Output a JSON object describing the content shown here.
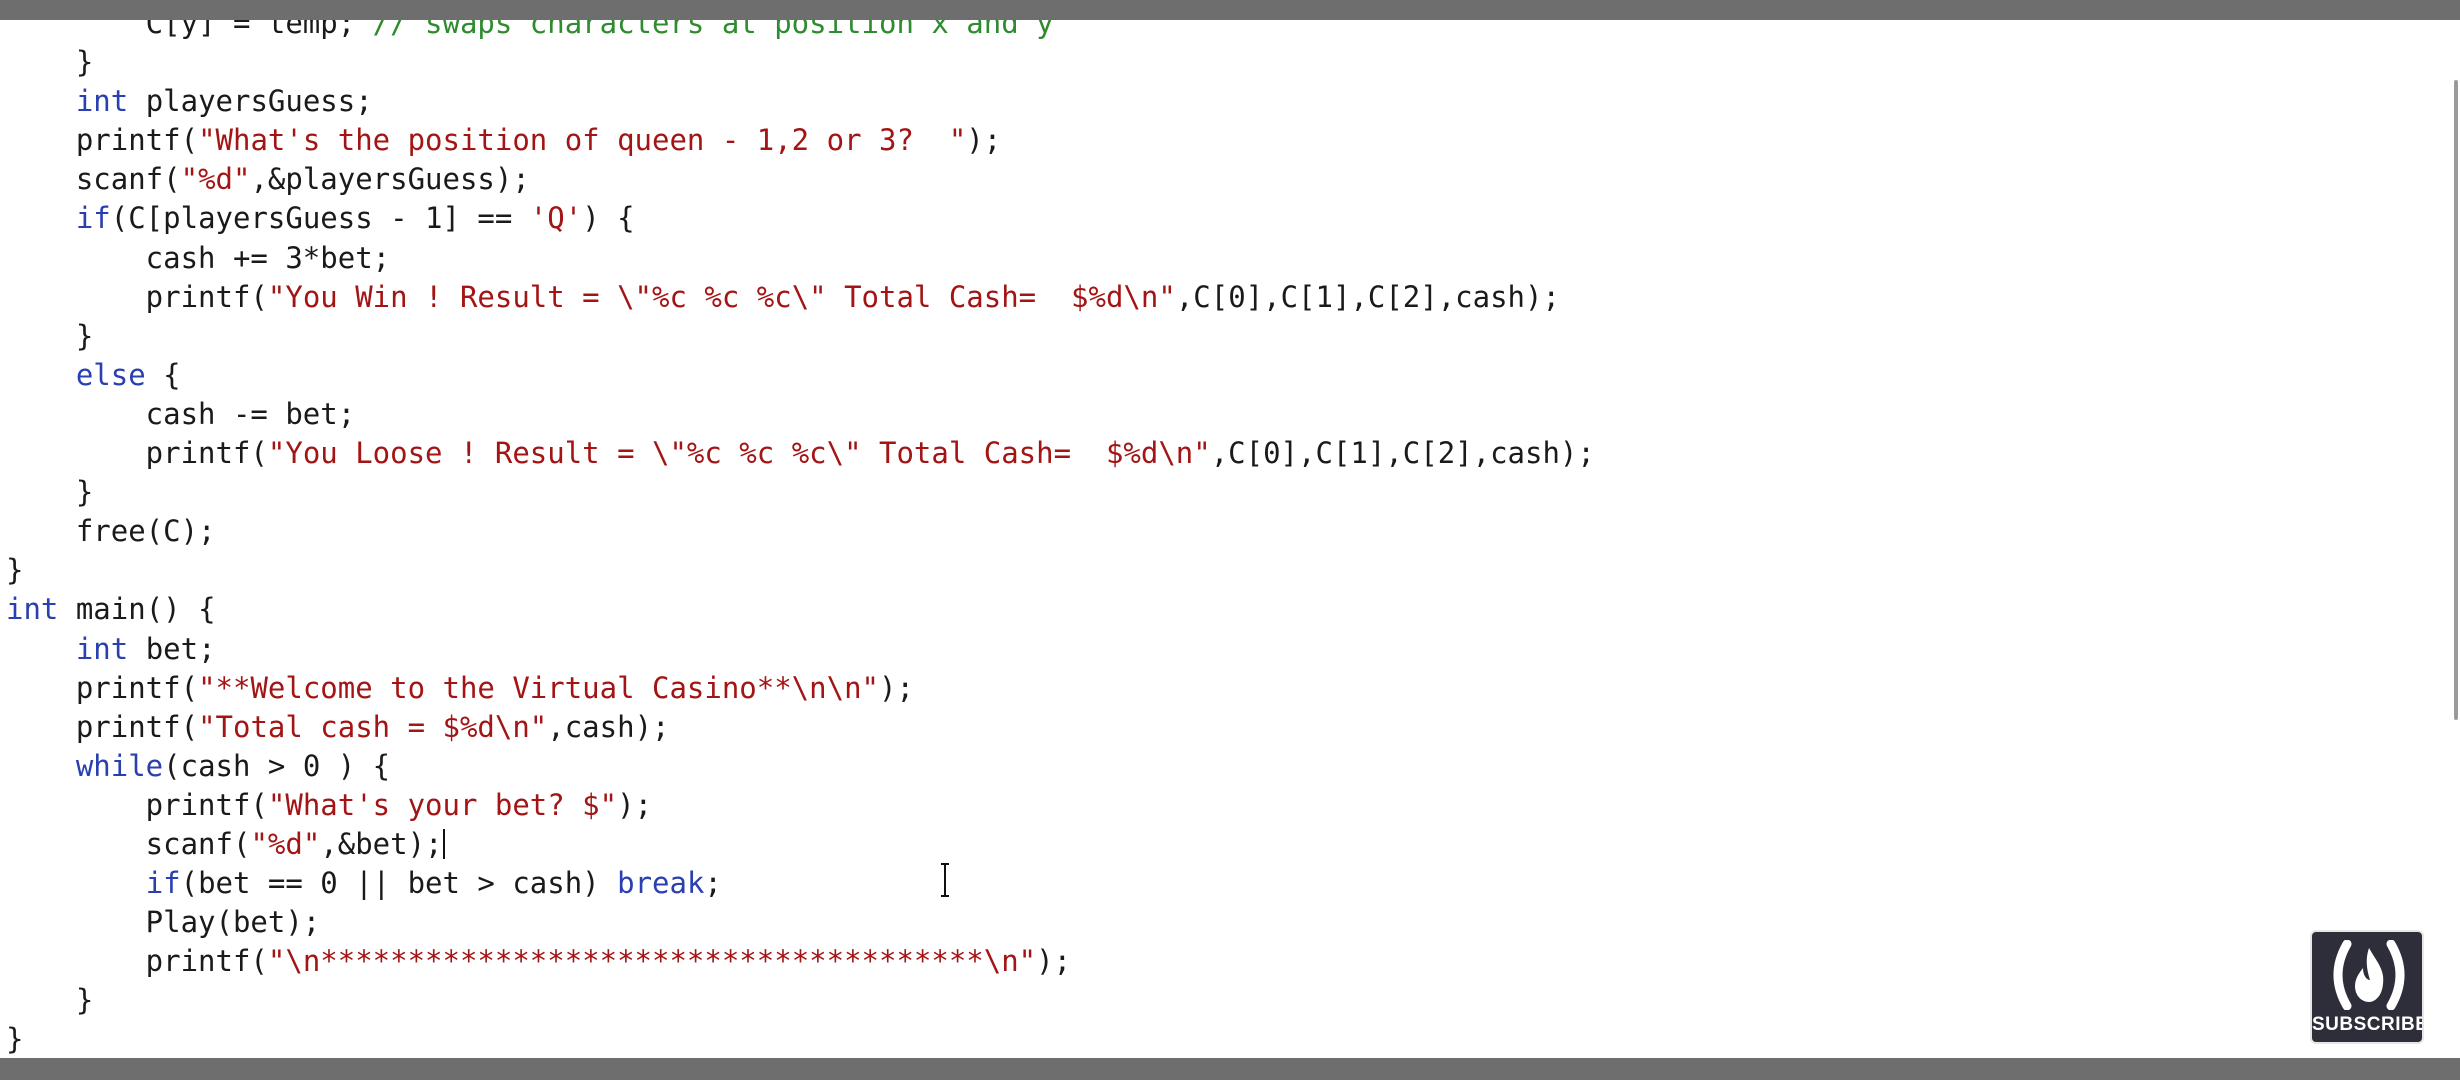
{
  "code_lines": [
    [
      {
        "t": "txt",
        "v": "        C[y] = temp; "
      },
      {
        "t": "cmt",
        "v": "// swaps characters at position x and y"
      }
    ],
    [
      {
        "t": "txt",
        "v": "    }"
      }
    ],
    [
      {
        "t": "txt",
        "v": "    "
      },
      {
        "t": "kw",
        "v": "int"
      },
      {
        "t": "txt",
        "v": " playersGuess;"
      }
    ],
    [
      {
        "t": "txt",
        "v": "    printf("
      },
      {
        "t": "str",
        "v": "\"What's the position of queen - 1,2 or 3?  \""
      },
      {
        "t": "txt",
        "v": ");"
      }
    ],
    [
      {
        "t": "txt",
        "v": "    scanf("
      },
      {
        "t": "str",
        "v": "\"%d\""
      },
      {
        "t": "txt",
        "v": ",&playersGuess);"
      }
    ],
    [
      {
        "t": "txt",
        "v": "    "
      },
      {
        "t": "kw",
        "v": "if"
      },
      {
        "t": "txt",
        "v": "(C[playersGuess - 1] == "
      },
      {
        "t": "str",
        "v": "'Q'"
      },
      {
        "t": "txt",
        "v": ") {"
      }
    ],
    [
      {
        "t": "txt",
        "v": "        cash += 3*bet;"
      }
    ],
    [
      {
        "t": "txt",
        "v": "        printf("
      },
      {
        "t": "str",
        "v": "\"You Win ! Result = \\\"%c %c %c\\\" Total Cash=  $%d\\n\""
      },
      {
        "t": "txt",
        "v": ",C[0],C[1],C[2],cash);"
      }
    ],
    [
      {
        "t": "txt",
        "v": "    }"
      }
    ],
    [
      {
        "t": "txt",
        "v": "    "
      },
      {
        "t": "kw",
        "v": "else"
      },
      {
        "t": "txt",
        "v": " {"
      }
    ],
    [
      {
        "t": "txt",
        "v": "        cash -= bet;"
      }
    ],
    [
      {
        "t": "txt",
        "v": "        printf("
      },
      {
        "t": "str",
        "v": "\"You Loose ! Result = \\\"%c %c %c\\\" Total Cash=  $%d\\n\""
      },
      {
        "t": "txt",
        "v": ",C[0],C[1],C[2],cash);"
      }
    ],
    [
      {
        "t": "txt",
        "v": "    }"
      }
    ],
    [
      {
        "t": "txt",
        "v": "    free(C);"
      }
    ],
    [
      {
        "t": "txt",
        "v": "}"
      }
    ],
    [
      {
        "t": "kw",
        "v": "int"
      },
      {
        "t": "txt",
        "v": " main() {"
      }
    ],
    [
      {
        "t": "txt",
        "v": "    "
      },
      {
        "t": "kw",
        "v": "int"
      },
      {
        "t": "txt",
        "v": " bet;"
      }
    ],
    [
      {
        "t": "txt",
        "v": "    printf("
      },
      {
        "t": "str",
        "v": "\"**Welcome to the Virtual Casino**\\n\\n\""
      },
      {
        "t": "txt",
        "v": ");"
      }
    ],
    [
      {
        "t": "txt",
        "v": "    printf("
      },
      {
        "t": "str",
        "v": "\"Total cash = $%d\\n\""
      },
      {
        "t": "txt",
        "v": ",cash);"
      }
    ],
    [
      {
        "t": "txt",
        "v": "    "
      },
      {
        "t": "kw",
        "v": "while"
      },
      {
        "t": "txt",
        "v": "(cash > 0 ) {"
      }
    ],
    [
      {
        "t": "txt",
        "v": "        printf("
      },
      {
        "t": "str",
        "v": "\"What's your bet? $\""
      },
      {
        "t": "txt",
        "v": ");"
      }
    ],
    [
      {
        "t": "txt",
        "v": "        scanf("
      },
      {
        "t": "str",
        "v": "\"%d\""
      },
      {
        "t": "txt",
        "v": ",&bet);"
      },
      {
        "t": "caret",
        "v": ""
      }
    ],
    [
      {
        "t": "txt",
        "v": "        "
      },
      {
        "t": "kw",
        "v": "if"
      },
      {
        "t": "txt",
        "v": "(bet == 0 || bet > cash) "
      },
      {
        "t": "kw",
        "v": "break"
      },
      {
        "t": "txt",
        "v": ";"
      }
    ],
    [
      {
        "t": "txt",
        "v": "        Play(bet);"
      }
    ],
    [
      {
        "t": "txt",
        "v": "        printf("
      },
      {
        "t": "str",
        "v": "\"\\n**************************************\\n\""
      },
      {
        "t": "txt",
        "v": ");"
      }
    ],
    [
      {
        "t": "txt",
        "v": "    }"
      }
    ],
    [
      {
        "t": "txt",
        "v": "}"
      }
    ]
  ],
  "badge": {
    "label": "SUBSCRIBE",
    "icon": "flame-in-parentheses-icon"
  },
  "colors": {
    "keyword": "#2a3fb0",
    "string": "#a31515",
    "comment": "#2e8b2e",
    "text": "#1a1a1a",
    "chrome_bar": "#6e6e6e",
    "badge_bg": "#2e2e3a"
  }
}
